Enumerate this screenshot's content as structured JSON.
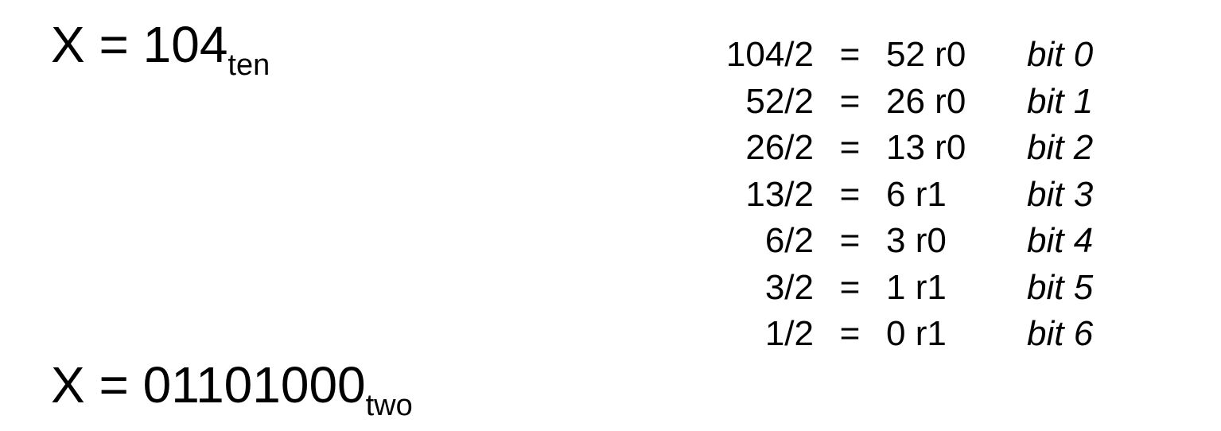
{
  "decimal_equation": {
    "lhs": "X = 104",
    "base": "ten"
  },
  "binary_equation": {
    "lhs": "X = 01101000",
    "base": "two"
  },
  "divisions": [
    {
      "expr": "104/2",
      "eq": "=",
      "result": "52 r0",
      "bit": "bit 0"
    },
    {
      "expr": "52/2",
      "eq": "=",
      "result": "26 r0",
      "bit": "bit 1"
    },
    {
      "expr": "26/2",
      "eq": "=",
      "result": "13 r0",
      "bit": "bit 2"
    },
    {
      "expr": "13/2",
      "eq": "=",
      "result": "6 r1",
      "bit": "bit 3"
    },
    {
      "expr": "6/2",
      "eq": "=",
      "result": "3 r0",
      "bit": "bit 4"
    },
    {
      "expr": "3/2",
      "eq": "=",
      "result": "1 r1",
      "bit": "bit 5"
    },
    {
      "expr": "1/2",
      "eq": "=",
      "result": "0 r1",
      "bit": "bit 6"
    }
  ]
}
